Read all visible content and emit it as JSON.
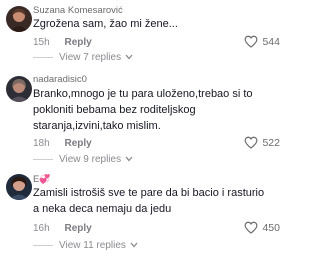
{
  "comments": [
    {
      "username": "Suzana Komesarović",
      "username_suffix": "",
      "text": "Zgrožena sam, žao mi žene...",
      "time": "15h",
      "reply_label": "Reply",
      "likes": "544",
      "view_replies": "View 7 replies"
    },
    {
      "username": "nadaradisic0",
      "username_suffix": "",
      "text": "Branko,mnogo je tu para uloženo,trebao si to pokloniti bebama bez roditeljskog staranja,izvini,tako mislim.",
      "time": "18h",
      "reply_label": "Reply",
      "likes": "522",
      "view_replies": "View 9 replies"
    },
    {
      "username": "E",
      "username_suffix": "💞",
      "text": "Zamisli istrošiš sve te pare da bi bacio i rasturio a neka deca nemaju da jedu",
      "time": "16h",
      "reply_label": "Reply",
      "likes": "450",
      "view_replies": "View 11 replies"
    }
  ],
  "colors": {
    "text": "#161823",
    "secondary": "#8a8b91",
    "heart_outline": "#6b6b6b"
  },
  "icons": [
    "heart-outline-icon",
    "chevron-down-icon"
  ]
}
